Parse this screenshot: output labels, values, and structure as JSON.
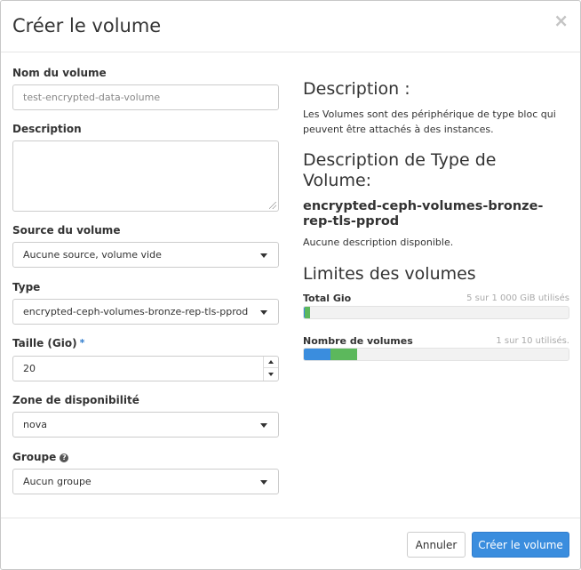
{
  "modal": {
    "title": "Créer le volume",
    "close_glyph": "×"
  },
  "form": {
    "name_label": "Nom du volume",
    "name_value": "test-encrypted-data-volume",
    "description_label": "Description",
    "description_value": "",
    "source_label": "Source du volume",
    "source_value": "Aucune source, volume vide",
    "type_label": "Type",
    "type_value": "encrypted-ceph-volumes-bronze-rep-tls-pprod",
    "size_label": "Taille (Gio)",
    "size_required_mark": "*",
    "size_value": "20",
    "zone_label": "Zone de disponibilité",
    "zone_value": "nova",
    "group_label": "Groupe",
    "group_help_glyph": "?",
    "group_value": "Aucun groupe"
  },
  "info": {
    "description_heading": "Description :",
    "description_text": "Les Volumes sont des périphérique de type bloc qui peuvent être attachés à des instances.",
    "type_heading": "Description de Type de Volume:",
    "type_name": "encrypted-ceph-volumes-bronze-rep-tls-pprod",
    "type_desc": "Aucune description disponible.",
    "limits_heading": "Limites des volumes",
    "quotas": [
      {
        "label": "Total Gio",
        "text": "5 sur 1 000 GiB utilisés",
        "used_fraction": 0.005,
        "requested_fraction": 0.02
      },
      {
        "label": "Nombre de volumes",
        "text": "1 sur 10 utilisés.",
        "used_fraction": 0.1,
        "requested_fraction": 0.1
      }
    ]
  },
  "footer": {
    "cancel_label": "Annuler",
    "submit_label": "Créer le volume"
  },
  "colors": {
    "primary": "#3a8dde",
    "bar_used": "#3a8dde",
    "bar_requested": "#5cb85c"
  }
}
